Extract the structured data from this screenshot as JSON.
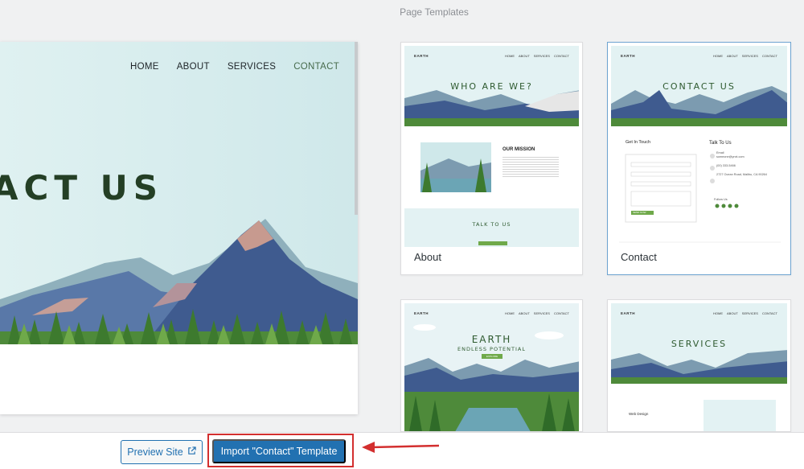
{
  "header": {
    "section_title": "Page Templates"
  },
  "preview": {
    "nav": [
      "HOME",
      "ABOUT",
      "SERVICES",
      "CONTACT"
    ],
    "hero_title": "ACT US"
  },
  "cards": {
    "about": {
      "label": "About",
      "logo": "EARTH",
      "nav": [
        "HOME",
        "ABOUT",
        "SERVICES",
        "CONTACT"
      ],
      "hero_title": "WHO ARE WE?",
      "mission_title": "OUR MISSION",
      "cta_title": "TALK TO US"
    },
    "contact": {
      "label": "Contact",
      "logo": "EARTH",
      "nav": [
        "HOME",
        "ABOUT",
        "SERVICES",
        "CONTACT"
      ],
      "hero_title": "CONTACT US",
      "form_title": "Get In Touch",
      "info_title": "Talk To Us",
      "phone_label": "Email",
      "email_value": "someone@ynxt.com",
      "phone_value": "(00) 333-5466",
      "address": "2727 Ocean Road, Malibu, CA 90264",
      "follow": "Follow Us",
      "send_label": "SEND NOW"
    },
    "home": {
      "logo": "EARTH",
      "nav": [
        "HOME",
        "ABOUT",
        "SERVICES",
        "CONTACT"
      ],
      "hero_title": "EARTH",
      "hero_subtitle": "ENDLESS POTENTIAL",
      "cta_label": "EXPLORE"
    },
    "services": {
      "logo": "EARTH",
      "nav": [
        "HOME",
        "ABOUT",
        "SERVICES",
        "CONTACT"
      ],
      "hero_title": "SERVICES",
      "item": "Web Design"
    }
  },
  "footer": {
    "preview_label": "Preview Site",
    "import_label": "Import \"Contact\" Template"
  },
  "colors": {
    "primary": "#2271b1",
    "highlight": "#d32f2f",
    "title_green": "#2e5a2f"
  }
}
